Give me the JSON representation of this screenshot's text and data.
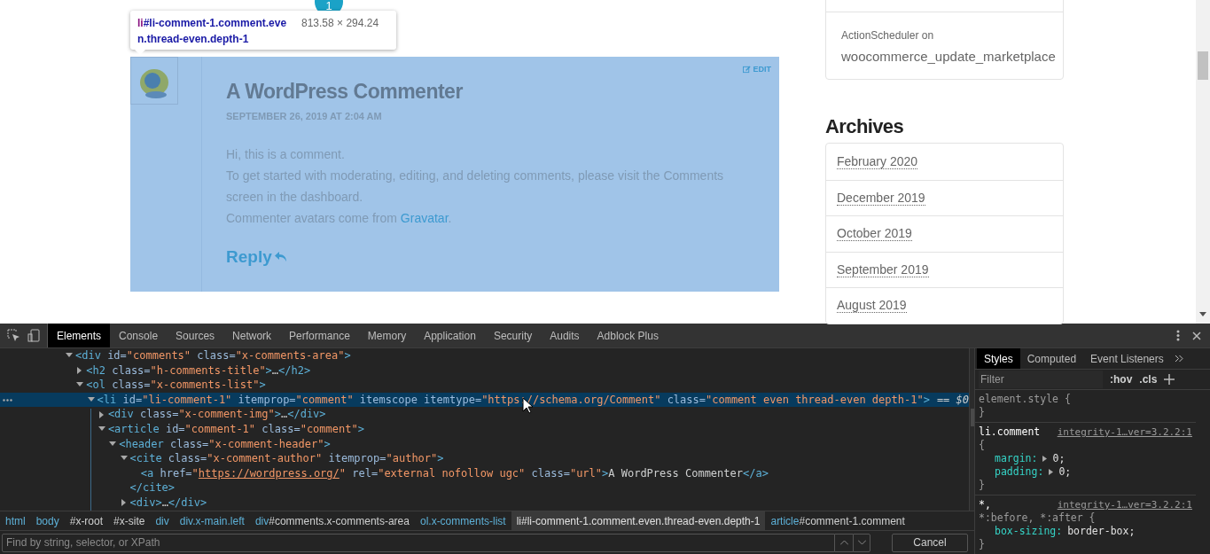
{
  "page": {
    "comments_badge": "1",
    "inspect_tooltip": {
      "tag": "li",
      "selector": "#li-comment-1.comment.even.thread-even.depth-1",
      "size": "813.58 × 294.24"
    },
    "comment": {
      "highlighted": true,
      "author": "A WordPress Commenter",
      "date": "SEPTEMBER 26, 2019 AT 2:04 AM",
      "edit_label": "EDIT",
      "reply_label": "Reply",
      "paragraphs": [
        {
          "text": "Hi, this is a comment."
        },
        {
          "text": "To get started with moderating, editing, and deleting comments, please visit the Comments screen in the dashboard."
        },
        {
          "text": "Commenter avatars come from ",
          "link": "Gravatar",
          "after": "."
        }
      ]
    },
    "sidebar": {
      "recent_item": {
        "meta": "ActionScheduler on",
        "title": "woocommerce_update_marketplace"
      },
      "archives": {
        "title": "Archives",
        "items": [
          "February 2020",
          "December 2019",
          "October 2019",
          "September 2019",
          "August 2019"
        ]
      }
    }
  },
  "devtools": {
    "main_tabs": [
      {
        "label": "Elements",
        "selected": true
      },
      {
        "label": "Console",
        "selected": false
      },
      {
        "label": "Sources",
        "selected": false
      },
      {
        "label": "Network",
        "selected": false
      },
      {
        "label": "Performance",
        "selected": false
      },
      {
        "label": "Memory",
        "selected": false
      },
      {
        "label": "Application",
        "selected": false
      },
      {
        "label": "Security",
        "selected": false
      },
      {
        "label": "Audits",
        "selected": false
      },
      {
        "label": "Adblock Plus",
        "selected": false
      }
    ],
    "dom_tree": [
      {
        "expanded": true,
        "selected": false,
        "tokens": [
          {
            "kind": "tag",
            "text": "<div"
          },
          {
            "kind": "attr",
            "text": " id="
          },
          {
            "kind": "val",
            "text": "\"comments\""
          },
          {
            "kind": "attr",
            "text": " class="
          },
          {
            "kind": "val",
            "text": "\"x-comments-area\""
          },
          {
            "kind": "tag",
            "text": ">"
          }
        ],
        "children": [
          {
            "expanded": false,
            "selected": false,
            "tokens": [
              {
                "kind": "tag",
                "text": "<h2"
              },
              {
                "kind": "attr",
                "text": " class="
              },
              {
                "kind": "val",
                "text": "\"h-comments-title\""
              },
              {
                "kind": "tag",
                "text": ">"
              },
              {
                "kind": "text",
                "text": "…"
              },
              {
                "kind": "tag",
                "text": "</h2>"
              }
            ]
          },
          {
            "expanded": true,
            "selected": false,
            "tokens": [
              {
                "kind": "tag",
                "text": "<ol"
              },
              {
                "kind": "attr",
                "text": " class="
              },
              {
                "kind": "val",
                "text": "\"x-comments-list\""
              },
              {
                "kind": "tag",
                "text": ">"
              }
            ],
            "children": [
              {
                "expanded": true,
                "selected": true,
                "suffix": "== $0",
                "tokens": [
                  {
                    "kind": "tag",
                    "text": "<li"
                  },
                  {
                    "kind": "attr",
                    "text": " id="
                  },
                  {
                    "kind": "val",
                    "text": "\"li-comment-1\""
                  },
                  {
                    "kind": "attr",
                    "text": " itemprop="
                  },
                  {
                    "kind": "val",
                    "text": "\"comment\""
                  },
                  {
                    "kind": "attr",
                    "text": " itemscope itemtype="
                  },
                  {
                    "kind": "val",
                    "text": "\"https://schema.org/Comment\""
                  },
                  {
                    "kind": "attr",
                    "text": " class="
                  },
                  {
                    "kind": "val",
                    "text": "\"comment even thread-even depth-1\""
                  },
                  {
                    "kind": "tag",
                    "text": ">"
                  }
                ],
                "children": [
                  {
                    "expanded": false,
                    "selected": false,
                    "tokens": [
                      {
                        "kind": "tag",
                        "text": "<div"
                      },
                      {
                        "kind": "attr",
                        "text": " class="
                      },
                      {
                        "kind": "val",
                        "text": "\"x-comment-img\""
                      },
                      {
                        "kind": "tag",
                        "text": ">"
                      },
                      {
                        "kind": "text",
                        "text": "…"
                      },
                      {
                        "kind": "tag",
                        "text": "</div>"
                      }
                    ]
                  },
                  {
                    "expanded": true,
                    "selected": false,
                    "tokens": [
                      {
                        "kind": "tag",
                        "text": "<article"
                      },
                      {
                        "kind": "attr",
                        "text": " id="
                      },
                      {
                        "kind": "val",
                        "text": "\"comment-1\""
                      },
                      {
                        "kind": "attr",
                        "text": " class="
                      },
                      {
                        "kind": "val",
                        "text": "\"comment\""
                      },
                      {
                        "kind": "tag",
                        "text": ">"
                      }
                    ],
                    "children": [
                      {
                        "expanded": true,
                        "selected": false,
                        "tokens": [
                          {
                            "kind": "tag",
                            "text": "<header"
                          },
                          {
                            "kind": "attr",
                            "text": " class="
                          },
                          {
                            "kind": "val",
                            "text": "\"x-comment-header\""
                          },
                          {
                            "kind": "tag",
                            "text": ">"
                          }
                        ],
                        "children": [
                          {
                            "expanded": true,
                            "selected": false,
                            "closing": "</cite>",
                            "tokens": [
                              {
                                "kind": "tag",
                                "text": "<cite"
                              },
                              {
                                "kind": "attr",
                                "text": " class="
                              },
                              {
                                "kind": "val",
                                "text": "\"x-comment-author\""
                              },
                              {
                                "kind": "attr",
                                "text": " itemprop="
                              },
                              {
                                "kind": "val",
                                "text": "\"author\""
                              },
                              {
                                "kind": "tag",
                                "text": ">"
                              }
                            ],
                            "children": [
                              {
                                "selected": false,
                                "tokens": [
                                  {
                                    "kind": "tag",
                                    "text": "<a"
                                  },
                                  {
                                    "kind": "attr",
                                    "text": " href="
                                  },
                                  {
                                    "kind": "val",
                                    "text": "\""
                                  },
                                  {
                                    "kind": "link",
                                    "text": "https://wordpress.org/"
                                  },
                                  {
                                    "kind": "val",
                                    "text": "\""
                                  },
                                  {
                                    "kind": "attr",
                                    "text": " rel="
                                  },
                                  {
                                    "kind": "val",
                                    "text": "\"external nofollow ugc\""
                                  },
                                  {
                                    "kind": "attr",
                                    "text": " class="
                                  },
                                  {
                                    "kind": "val",
                                    "text": "\"url\""
                                  },
                                  {
                                    "kind": "tag",
                                    "text": ">"
                                  },
                                  {
                                    "kind": "text",
                                    "text": "A WordPress Commenter"
                                  },
                                  {
                                    "kind": "tag",
                                    "text": "</a>"
                                  }
                                ]
                              }
                            ]
                          },
                          {
                            "expanded": false,
                            "selected": false,
                            "tokens": [
                              {
                                "kind": "tag",
                                "text": "<div>"
                              },
                              {
                                "kind": "text",
                                "text": "…"
                              },
                              {
                                "kind": "tag",
                                "text": "</div>"
                              }
                            ]
                          }
                        ]
                      }
                    ]
                  }
                ]
              }
            ]
          }
        ]
      }
    ],
    "breadcrumbs": [
      {
        "tag": "html",
        "selected": false
      },
      {
        "tag": "body",
        "selected": false
      },
      {
        "rest": "#x-root",
        "selected": false
      },
      {
        "rest": "#x-site",
        "selected": false
      },
      {
        "tag": "div",
        "selected": false
      },
      {
        "tag": "div.x-main.left",
        "selected": false
      },
      {
        "tag": "div",
        "rest": "#comments.x-comments-area",
        "selected": false
      },
      {
        "tag": "ol.x-comments-list",
        "selected": false
      },
      {
        "tag": "li",
        "rest": "#li-comment-1.comment.even.thread-even.depth-1",
        "selected": true
      },
      {
        "tag": "article",
        "rest": "#comment-1.comment",
        "selected": false
      }
    ],
    "search": {
      "placeholder": "Find by string, selector, or XPath"
    },
    "cancel_label": "Cancel",
    "side_tabs": [
      {
        "label": "Styles",
        "selected": true
      },
      {
        "label": "Computed",
        "selected": false
      },
      {
        "label": "Event Listeners",
        "selected": false
      }
    ],
    "filter": {
      "placeholder": "Filter"
    },
    "filter_buttons": [
      ":hov",
      ".cls"
    ],
    "rules": [
      {
        "header": [
          {
            "kind": "plain",
            "text": "element.style {"
          }
        ],
        "close": "}"
      },
      {
        "header": [
          {
            "kind": "selector",
            "text": "li.comment"
          },
          {
            "kind": "plain",
            "text": "{"
          }
        ],
        "source": "integrity-1…ver=3.2.2:1",
        "declarations": [
          {
            "prop": "margin:",
            "value": "0;",
            "expandable": true
          },
          {
            "prop": "padding:",
            "value": "0;",
            "expandable": true
          }
        ],
        "close": "}"
      },
      {
        "header": [
          {
            "kind": "selector",
            "text": "*,"
          },
          {
            "kind": "plain",
            "text": "*:before, *:after {"
          }
        ],
        "source": "integrity-1…ver=3.2.2:1",
        "declarations": [
          {
            "prop": "box-sizing:",
            "value": "border-box;",
            "expandable": false
          }
        ],
        "close": "}"
      }
    ]
  }
}
